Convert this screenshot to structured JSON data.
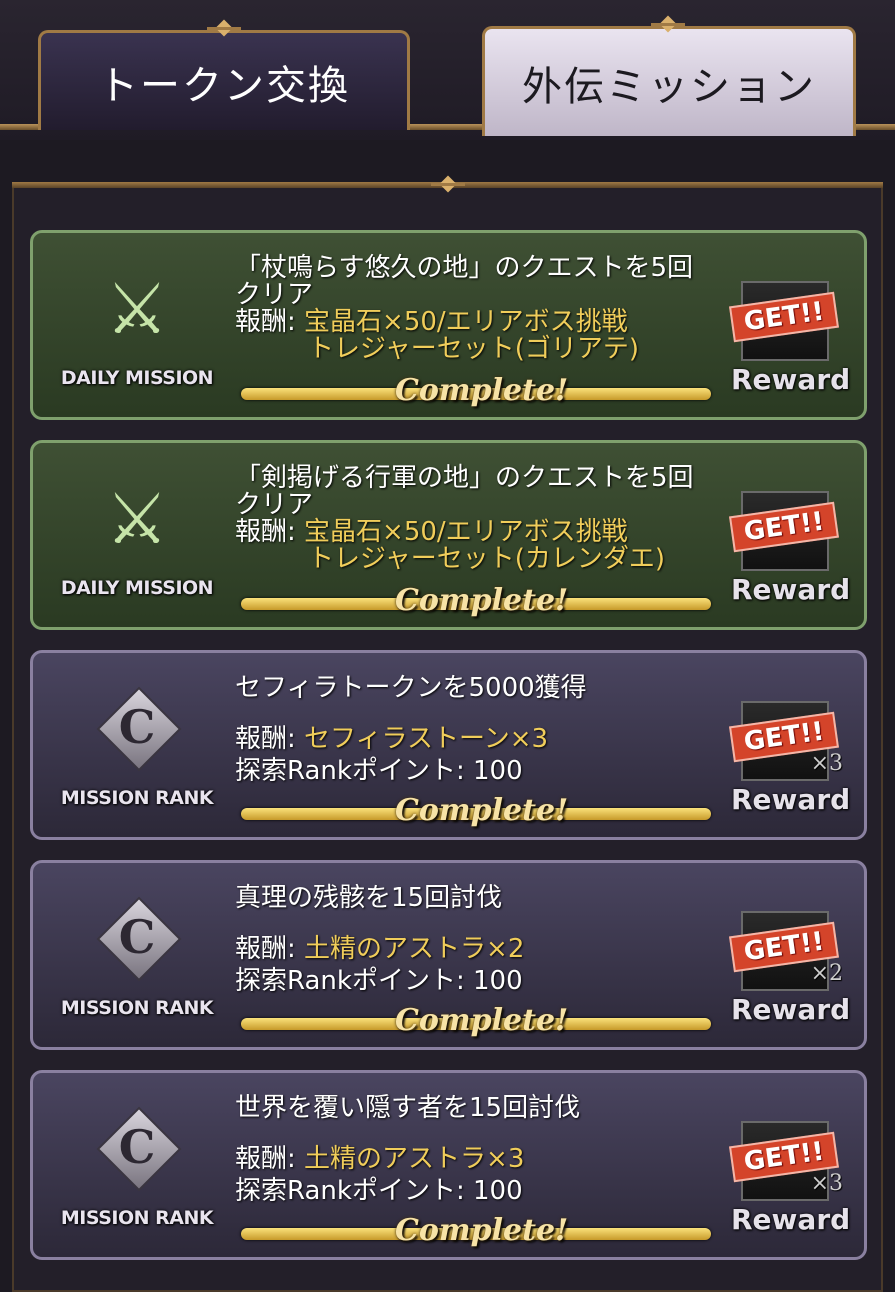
{
  "tabs": [
    {
      "label": "トークン交換"
    },
    {
      "label": "外伝ミッション"
    }
  ],
  "missions": [
    {
      "type": "daily",
      "emblem": "DAILY MISSION",
      "title_line1": "「杖鳴らす悠久の地」のクエストを5回",
      "title_line2": "クリア",
      "reward_label": "報酬: ",
      "reward_line1": "宝晶石×50/エリアボス挑戦",
      "reward_line2": "トレジャーセット(ゴリアテ)",
      "status": "Complete!",
      "get_label": "GET!!",
      "reward_button": "Reward"
    },
    {
      "type": "daily",
      "emblem": "DAILY MISSION",
      "title_line1": "「剣掲げる行軍の地」のクエストを5回",
      "title_line2": "クリア",
      "reward_label": "報酬: ",
      "reward_line1": "宝晶石×50/エリアボス挑戦",
      "reward_line2": "トレジャーセット(カレンダエ)",
      "status": "Complete!",
      "get_label": "GET!!",
      "reward_button": "Reward"
    },
    {
      "type": "rank",
      "emblem": "MISSION RANK",
      "rank_letter": "C",
      "title_line1": "セフィラトークンを5000獲得",
      "reward_label": "報酬: ",
      "reward_line1": "セフィラストーン×3",
      "rank_points": "探索Rankポイント: 100",
      "status": "Complete!",
      "get_label": "GET!!",
      "quantity": "×3",
      "reward_button": "Reward"
    },
    {
      "type": "rank",
      "emblem": "MISSION RANK",
      "rank_letter": "C",
      "title_line1": "真理の残骸を15回討伐",
      "reward_label": "報酬: ",
      "reward_line1": "土精のアストラ×2",
      "rank_points": "探索Rankポイント: 100",
      "status": "Complete!",
      "get_label": "GET!!",
      "quantity": "×2",
      "reward_button": "Reward"
    },
    {
      "type": "rank",
      "emblem": "MISSION RANK",
      "rank_letter": "C",
      "title_line1": "世界を覆い隠す者を15回討伐",
      "reward_label": "報酬: ",
      "reward_line1": "土精のアストラ×3",
      "rank_points": "探索Rankポイント: 100",
      "status": "Complete!",
      "get_label": "GET!!",
      "quantity": "×3",
      "reward_button": "Reward"
    }
  ],
  "colors": {
    "daily_bg": "#3f5034",
    "rank_bg": "#4a4560",
    "reward_text": "#f0cd5a",
    "get_badge": "#d4442a",
    "progress_bar": "#e8c04a"
  }
}
